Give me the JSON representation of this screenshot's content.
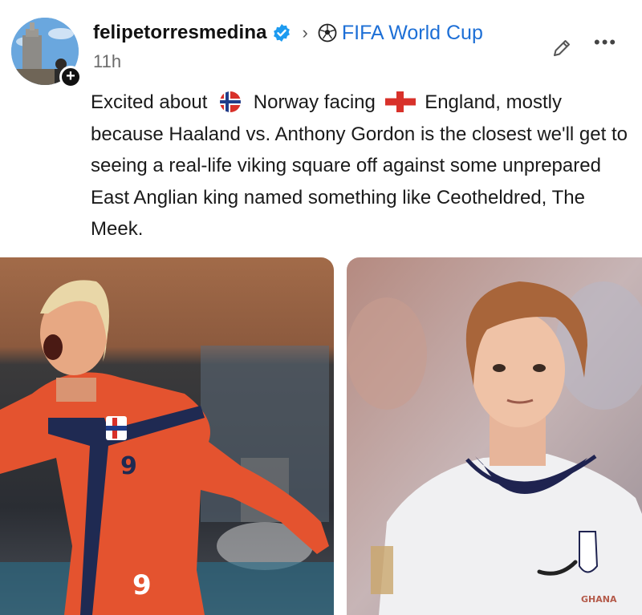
{
  "post": {
    "author": "felipetorresmedina",
    "community": "FIFA World Cup",
    "timestamp": "11h",
    "text_1": "Excited about",
    "text_2": "Norway facing",
    "text_3": "England, mostly because Haaland vs. Anthony Gordon is the closest we'll get to seeing a real-life viking square off against some unprepared East Anglian king named something like Ceotheldred, The Meek."
  },
  "icons": {
    "verified": "verified-badge-icon",
    "separator": "chevron-right-icon",
    "community": "soccer-ball-icon",
    "edit": "pencil-icon",
    "more": "more-dots-icon",
    "follow": "plus-icon",
    "flag_norway": "norway-flag-icon",
    "flag_england": "england-flag-icon"
  },
  "images": {
    "left_jersey_number": "9",
    "left_shorts_number": "9",
    "right_crest_text": "GHANA"
  },
  "colors": {
    "accent": "#1d6fd6",
    "verified": "#1d9bf0",
    "norway_red": "#e0462b",
    "england_white": "#f2f2f4"
  }
}
